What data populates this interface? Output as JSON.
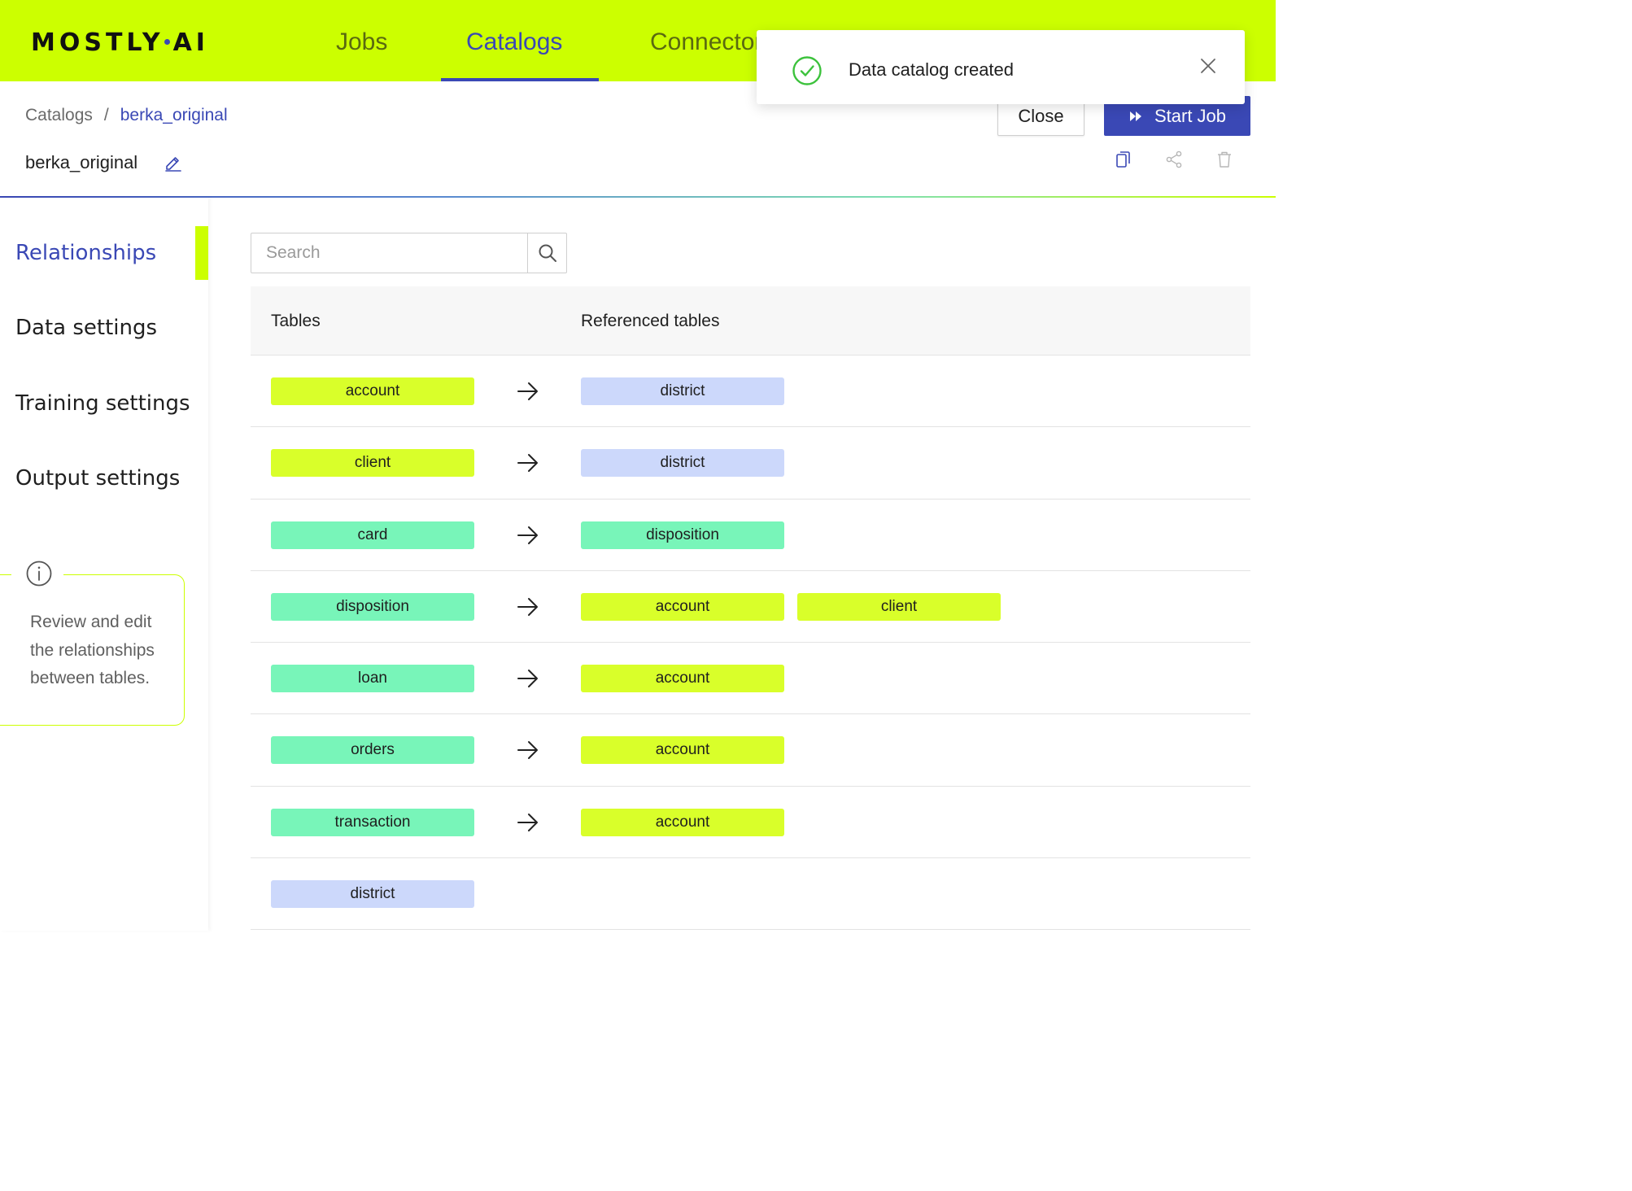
{
  "brand": {
    "logo_left": "MOSTLY",
    "logo_right": "AI"
  },
  "nav": {
    "tabs": [
      {
        "label": "Jobs"
      },
      {
        "label": "Catalogs",
        "active": true
      },
      {
        "label": "Connectors"
      }
    ]
  },
  "breadcrumb": {
    "root": "Catalogs",
    "separator": "/",
    "current": "berka_original"
  },
  "catalog": {
    "name": "berka_original"
  },
  "actions": {
    "close_label": "Close",
    "start_label": "Start Job"
  },
  "header_icons": [
    "copy-icon",
    "share-icon",
    "trash-icon"
  ],
  "sidebar": {
    "items": [
      {
        "label": "Relationships",
        "active": true
      },
      {
        "label": "Data settings"
      },
      {
        "label": "Training settings"
      },
      {
        "label": "Output settings"
      }
    ],
    "info": {
      "text": "Review and edit the relationships between tables."
    }
  },
  "search": {
    "placeholder": "Search",
    "value": ""
  },
  "table": {
    "headers": [
      "Tables",
      "Referenced tables"
    ],
    "rows": [
      {
        "table": {
          "name": "account",
          "color": "lime"
        },
        "refs": [
          {
            "name": "district",
            "color": "blue"
          }
        ]
      },
      {
        "table": {
          "name": "client",
          "color": "lime"
        },
        "refs": [
          {
            "name": "district",
            "color": "blue"
          }
        ]
      },
      {
        "table": {
          "name": "card",
          "color": "mint"
        },
        "refs": [
          {
            "name": "disposition",
            "color": "mint"
          }
        ]
      },
      {
        "table": {
          "name": "disposition",
          "color": "mint"
        },
        "refs": [
          {
            "name": "account",
            "color": "lime"
          },
          {
            "name": "client",
            "color": "lime"
          }
        ]
      },
      {
        "table": {
          "name": "loan",
          "color": "mint"
        },
        "refs": [
          {
            "name": "account",
            "color": "lime"
          }
        ]
      },
      {
        "table": {
          "name": "orders",
          "color": "mint"
        },
        "refs": [
          {
            "name": "account",
            "color": "lime"
          }
        ]
      },
      {
        "table": {
          "name": "transaction",
          "color": "mint"
        },
        "refs": [
          {
            "name": "account",
            "color": "lime"
          }
        ]
      },
      {
        "table": {
          "name": "district",
          "color": "blue"
        },
        "refs": []
      }
    ]
  },
  "toast": {
    "message": "Data catalog created",
    "status": "success"
  },
  "colors": {
    "brand_lime": "#ccff00",
    "primary": "#3a48b5",
    "tag_lime": "#d9ff2a",
    "tag_mint": "#78f5b9",
    "tag_blue": "#ccd8fb",
    "success": "#3cc23c"
  }
}
